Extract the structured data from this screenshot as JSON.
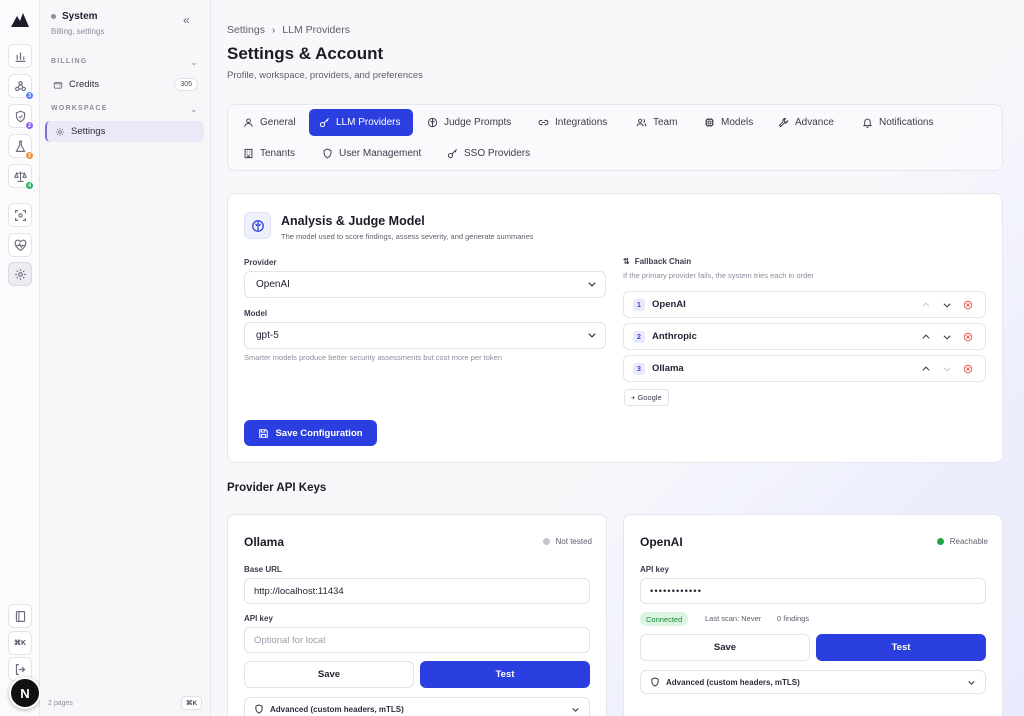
{
  "rail": {
    "icons": [
      "logo-icon",
      "chart-icon",
      "nodes-icon",
      "shield-icon",
      "flask-icon",
      "scale-icon",
      "scan-icon",
      "heart-pulse-icon",
      "gear-icon",
      "book-icon",
      "command-icon",
      "logout-icon"
    ],
    "badges": {
      "nodes": "3",
      "shield": "2",
      "flask": "2",
      "scale": "4"
    },
    "badge_colors": {
      "nodes": "#4f7ef5",
      "shield": "#8b5cf6",
      "flask": "#f28b3a",
      "scale": "#22b35e"
    },
    "shortcut_label": "⌘K",
    "avatar_letter": "N"
  },
  "sidebar": {
    "system_title": "System",
    "system_subtitle": "Billing, settings",
    "billing_header": "BILLING",
    "workspace_header": "WORKSPACE",
    "credits_label": "Credits",
    "credits_count": "305",
    "settings_label": "Settings",
    "footer_pages": "2 pages",
    "footer_kbd": "⌘K"
  },
  "breadcrumb": {
    "parent": "Settings",
    "separator": "›",
    "current": "LLM Providers"
  },
  "page": {
    "title": "Settings & Account",
    "subtitle": "Profile, workspace, providers, and preferences"
  },
  "tabs": [
    {
      "label": "General",
      "icon": "user-icon"
    },
    {
      "label": "LLM Providers",
      "icon": "key-icon",
      "active": true
    },
    {
      "label": "Judge Prompts",
      "icon": "brain-icon"
    },
    {
      "label": "Integrations",
      "icon": "link-icon"
    },
    {
      "label": "Team",
      "icon": "users-icon"
    },
    {
      "label": "Models",
      "icon": "cpu-icon"
    },
    {
      "label": "Advance",
      "icon": "wrench-icon"
    },
    {
      "label": "Notifications",
      "icon": "bell-icon"
    },
    {
      "label": "Tenants",
      "icon": "building-icon"
    },
    {
      "label": "User Management",
      "icon": "shield-icon"
    },
    {
      "label": "SSO Providers",
      "icon": "key-icon"
    }
  ],
  "judge": {
    "title": "Analysis & Judge Model",
    "subtitle": "The model used to score findings, assess severity, and generate summaries",
    "provider_label": "Provider",
    "provider_value": "OpenAI",
    "model_label": "Model",
    "model_value": "gpt-5",
    "model_hint": "Smarter models produce better security assessments but cost more per token",
    "fallback_title": "Fallback Chain",
    "fallback_subtitle": "If the primary provider fails, the system tries each in order",
    "fallback": [
      {
        "num": "1",
        "name": "OpenAI"
      },
      {
        "num": "2",
        "name": "Anthropic"
      },
      {
        "num": "3",
        "name": "Ollama"
      }
    ],
    "add_google": "+ Google",
    "save_button": "Save Configuration"
  },
  "api_keys": {
    "heading": "Provider API Keys",
    "ollama": {
      "title": "Ollama",
      "status": "Not tested",
      "status_color": "#c4c6cf",
      "base_url_label": "Base URL",
      "base_url_value": "http://localhost:11434",
      "api_key_label": "API key",
      "api_key_placeholder": "Optional for local",
      "save": "Save",
      "test": "Test",
      "advanced": "Advanced (custom headers, mTLS)"
    },
    "openai": {
      "title": "OpenAI",
      "status": "Reachable",
      "status_color": "#22a34a",
      "api_key_label": "API key",
      "api_key_value": "••••••••••••",
      "connected": "Connected",
      "last_scan": "Last scan: Never",
      "findings": "0 findings",
      "save": "Save",
      "test": "Test",
      "advanced": "Advanced (custom headers, mTLS)"
    }
  },
  "colors": {
    "accent": "#2b3fe0",
    "active_sidebar": "#ebe8f7",
    "danger": "#e0524f"
  }
}
